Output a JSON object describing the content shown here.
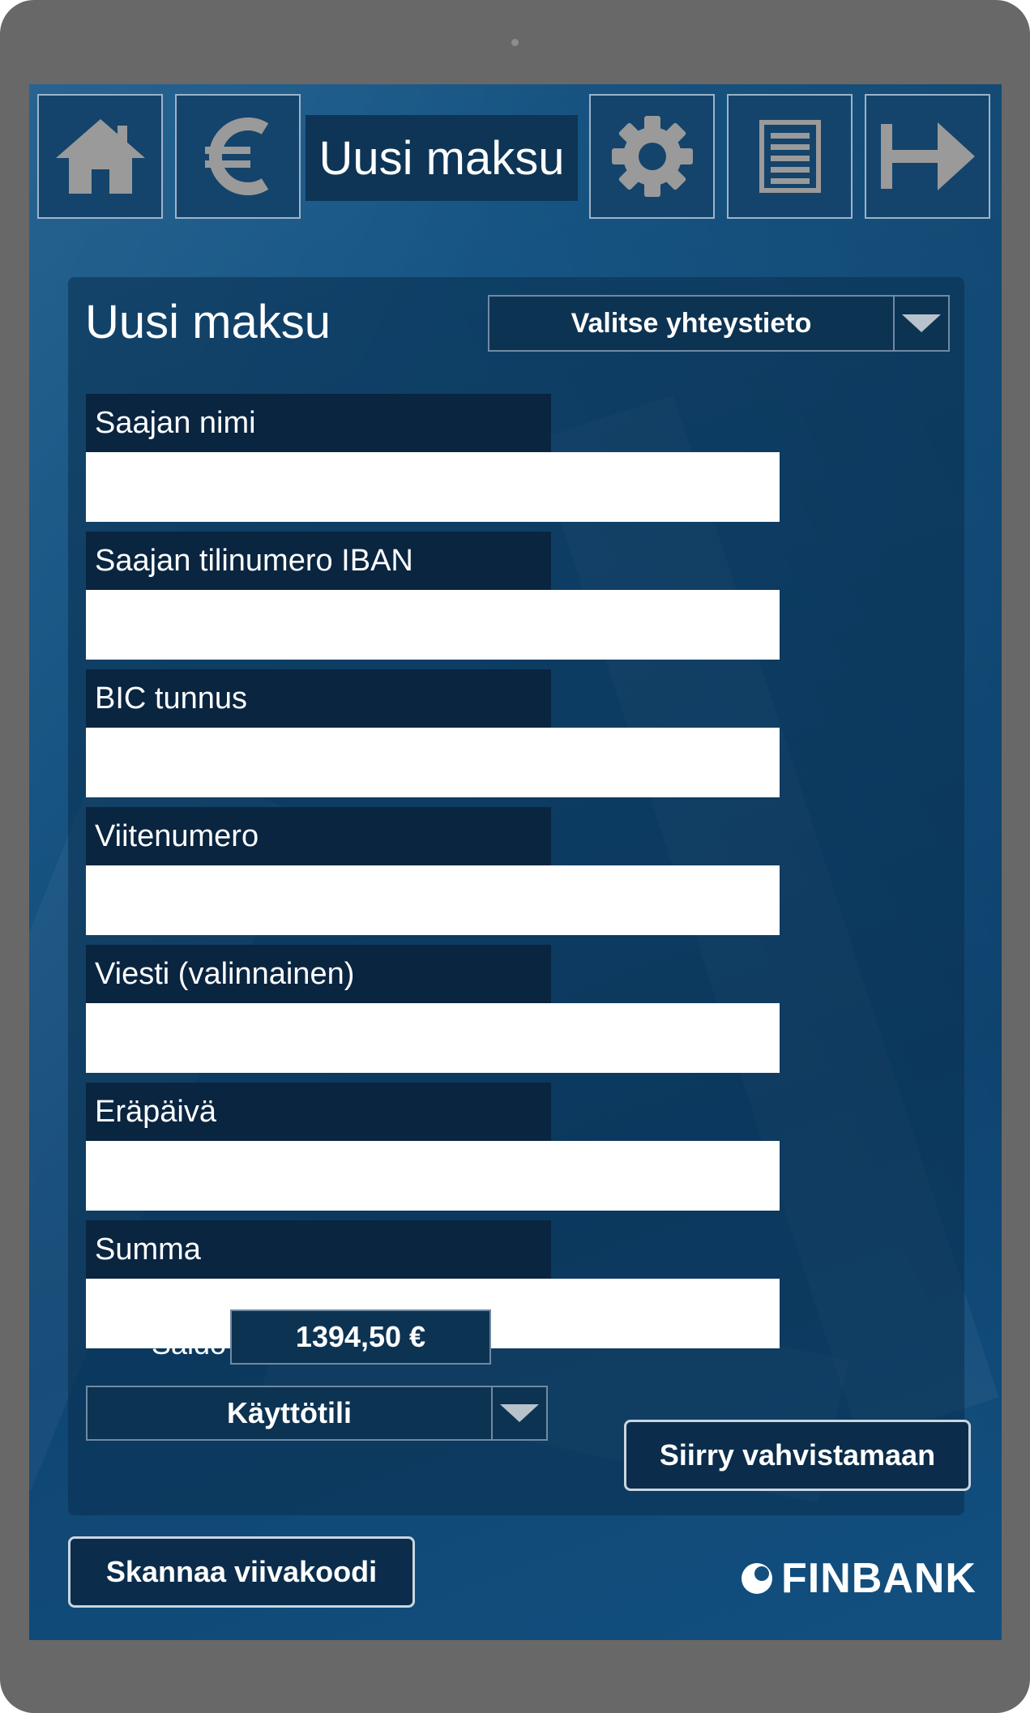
{
  "header": {
    "title": "Uusi maksu",
    "icons": [
      "home-icon",
      "euro-icon",
      "gear-icon",
      "document-icon",
      "logout-arrow-icon"
    ]
  },
  "panel": {
    "title": "Uusi maksu",
    "contact_select": "Valitse yhteystieto"
  },
  "fields": [
    {
      "label": "Saajan nimi",
      "value": ""
    },
    {
      "label": "Saajan tilinumero IBAN",
      "value": ""
    },
    {
      "label": "BIC tunnus",
      "value": ""
    },
    {
      "label": "Viitenumero",
      "value": ""
    },
    {
      "label": "Viesti (valinnainen)",
      "value": ""
    },
    {
      "label": "Eräpäivä",
      "value": ""
    },
    {
      "label": "Summa",
      "value": ""
    }
  ],
  "account": {
    "selected": "Käyttötili",
    "balance_label": "Saldo",
    "balance_value": "1394,50 €"
  },
  "buttons": {
    "continue": "Siirry vahvistamaan",
    "scan": "Skannaa viivakoodi"
  },
  "brand": {
    "name": "FINBANK"
  },
  "colors": {
    "background": "#135080",
    "panel": "#0e3555",
    "label_bg": "#0a2540",
    "icon_gray": "#9a9a9a"
  }
}
